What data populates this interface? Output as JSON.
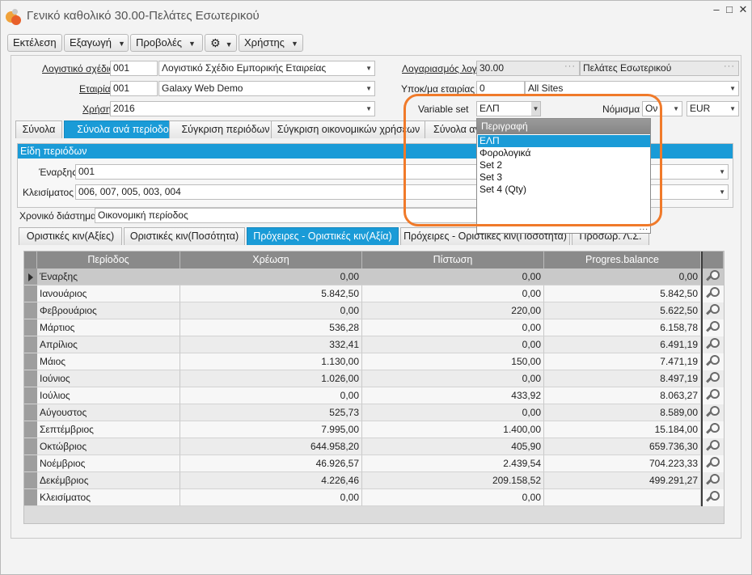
{
  "window": {
    "title": "Γενικό καθολικό 30.00-Πελάτες Εσωτερικού",
    "controls": [
      "–",
      "□",
      "✕"
    ]
  },
  "toolbar": {
    "execute": "Εκτέλεση",
    "export": "Εξαγωγή",
    "views": "Προβολές",
    "settings_icon": "gear-icon",
    "usage": "Χρήστης"
  },
  "form": {
    "chart_of_accounts": {
      "label": "Λογιστικό σχέδιο",
      "code": "001",
      "value": "Λογιστικό Σχέδιο Εμπορικής Εταιρείας"
    },
    "company": {
      "label": "Εταιρία",
      "code": "001",
      "value": "Galaxy Web Demo"
    },
    "fiscal_year": {
      "label": "Χρήση",
      "value": "2016"
    },
    "account": {
      "label": "Λογαριασμός λογιστικής",
      "code": "30.00",
      "value": "Πελάτες Εσωτερικού"
    },
    "branch": {
      "label": "Υποκ/μα εταιρίας",
      "code": "0",
      "value": "All Sites"
    },
    "variable_set": {
      "label": "Variable set",
      "value": "ΕΛΠ"
    },
    "currency": {
      "label": "Νόμισμα",
      "type": "Ον",
      "value": "EUR"
    }
  },
  "main_tabs": [
    "Σύνολα",
    "Σύνολα ανά περίοδο",
    "Σύγκριση περιόδων",
    "Σύγκριση οικονομικών χρήσεων",
    "Σύνολα αν"
  ],
  "period_group": {
    "header": "Είδη περιόδων",
    "start_label": "Έναρξης",
    "start_value": "001",
    "close_label": "Κλεισίματος",
    "close_value": "006, 007, 005, 003, 004"
  },
  "time_interval": {
    "label": "Χρονικό διάστημα",
    "value": "Οικονομική περίοδος"
  },
  "sub_tabs": [
    "Οριστικές κιν(Αξίες)",
    "Οριστικές κιν(Ποσότητα)",
    "Πρόχειρες - Οριστικές κιν(Αξία)",
    "Πρόχειρες - Οριστικές κιν(Ποσότητα)",
    "Προσωρ. Λ.Σ."
  ],
  "grid": {
    "columns": [
      "Περίοδος",
      "Χρέωση",
      "Πίστωση",
      "Progres.balance"
    ],
    "rows": [
      {
        "period": "Έναρξης",
        "debit": "0,00",
        "credit": "0,00",
        "balance": "0,00"
      },
      {
        "period": "Ιανουάριος",
        "debit": "5.842,50",
        "credit": "0,00",
        "balance": "5.842,50"
      },
      {
        "period": "Φεβρουάριος",
        "debit": "0,00",
        "credit": "220,00",
        "balance": "5.622,50"
      },
      {
        "period": "Μάρτιος",
        "debit": "536,28",
        "credit": "0,00",
        "balance": "6.158,78"
      },
      {
        "period": "Απρίλιος",
        "debit": "332,41",
        "credit": "0,00",
        "balance": "6.491,19"
      },
      {
        "period": "Μάιος",
        "debit": "1.130,00",
        "credit": "150,00",
        "balance": "7.471,19"
      },
      {
        "period": "Ιούνιος",
        "debit": "1.026,00",
        "credit": "0,00",
        "balance": "8.497,19"
      },
      {
        "period": "Ιούλιος",
        "debit": "0,00",
        "credit": "433,92",
        "balance": "8.063,27"
      },
      {
        "period": "Αύγουστος",
        "debit": "525,73",
        "credit": "0,00",
        "balance": "8.589,00"
      },
      {
        "period": "Σεπτέμβριος",
        "debit": "7.995,00",
        "credit": "1.400,00",
        "balance": "15.184,00"
      },
      {
        "period": "Οκτώβριος",
        "debit": "644.958,20",
        "credit": "405,90",
        "balance": "659.736,30"
      },
      {
        "period": "Νοέμβριος",
        "debit": "46.926,57",
        "credit": "2.439,54",
        "balance": "704.223,33"
      },
      {
        "period": "Δεκέμβριος",
        "debit": "4.226,46",
        "credit": "209.158,52",
        "balance": "499.291,27"
      },
      {
        "period": "Κλεισίματος",
        "debit": "0,00",
        "credit": "0,00",
        "balance": ""
      }
    ]
  },
  "popup": {
    "header": "Περιγραφή",
    "items": [
      "ΕΛΠ",
      "Φορολογικά",
      "Set 2",
      "Set 3",
      "Set 4 (Qty)"
    ],
    "selected": "ΕΛΠ",
    "grip": "..."
  },
  "colors": {
    "accent": "#1a9bd7",
    "highlight": "#f07a2a",
    "grid_header": "#8a8a8a"
  }
}
